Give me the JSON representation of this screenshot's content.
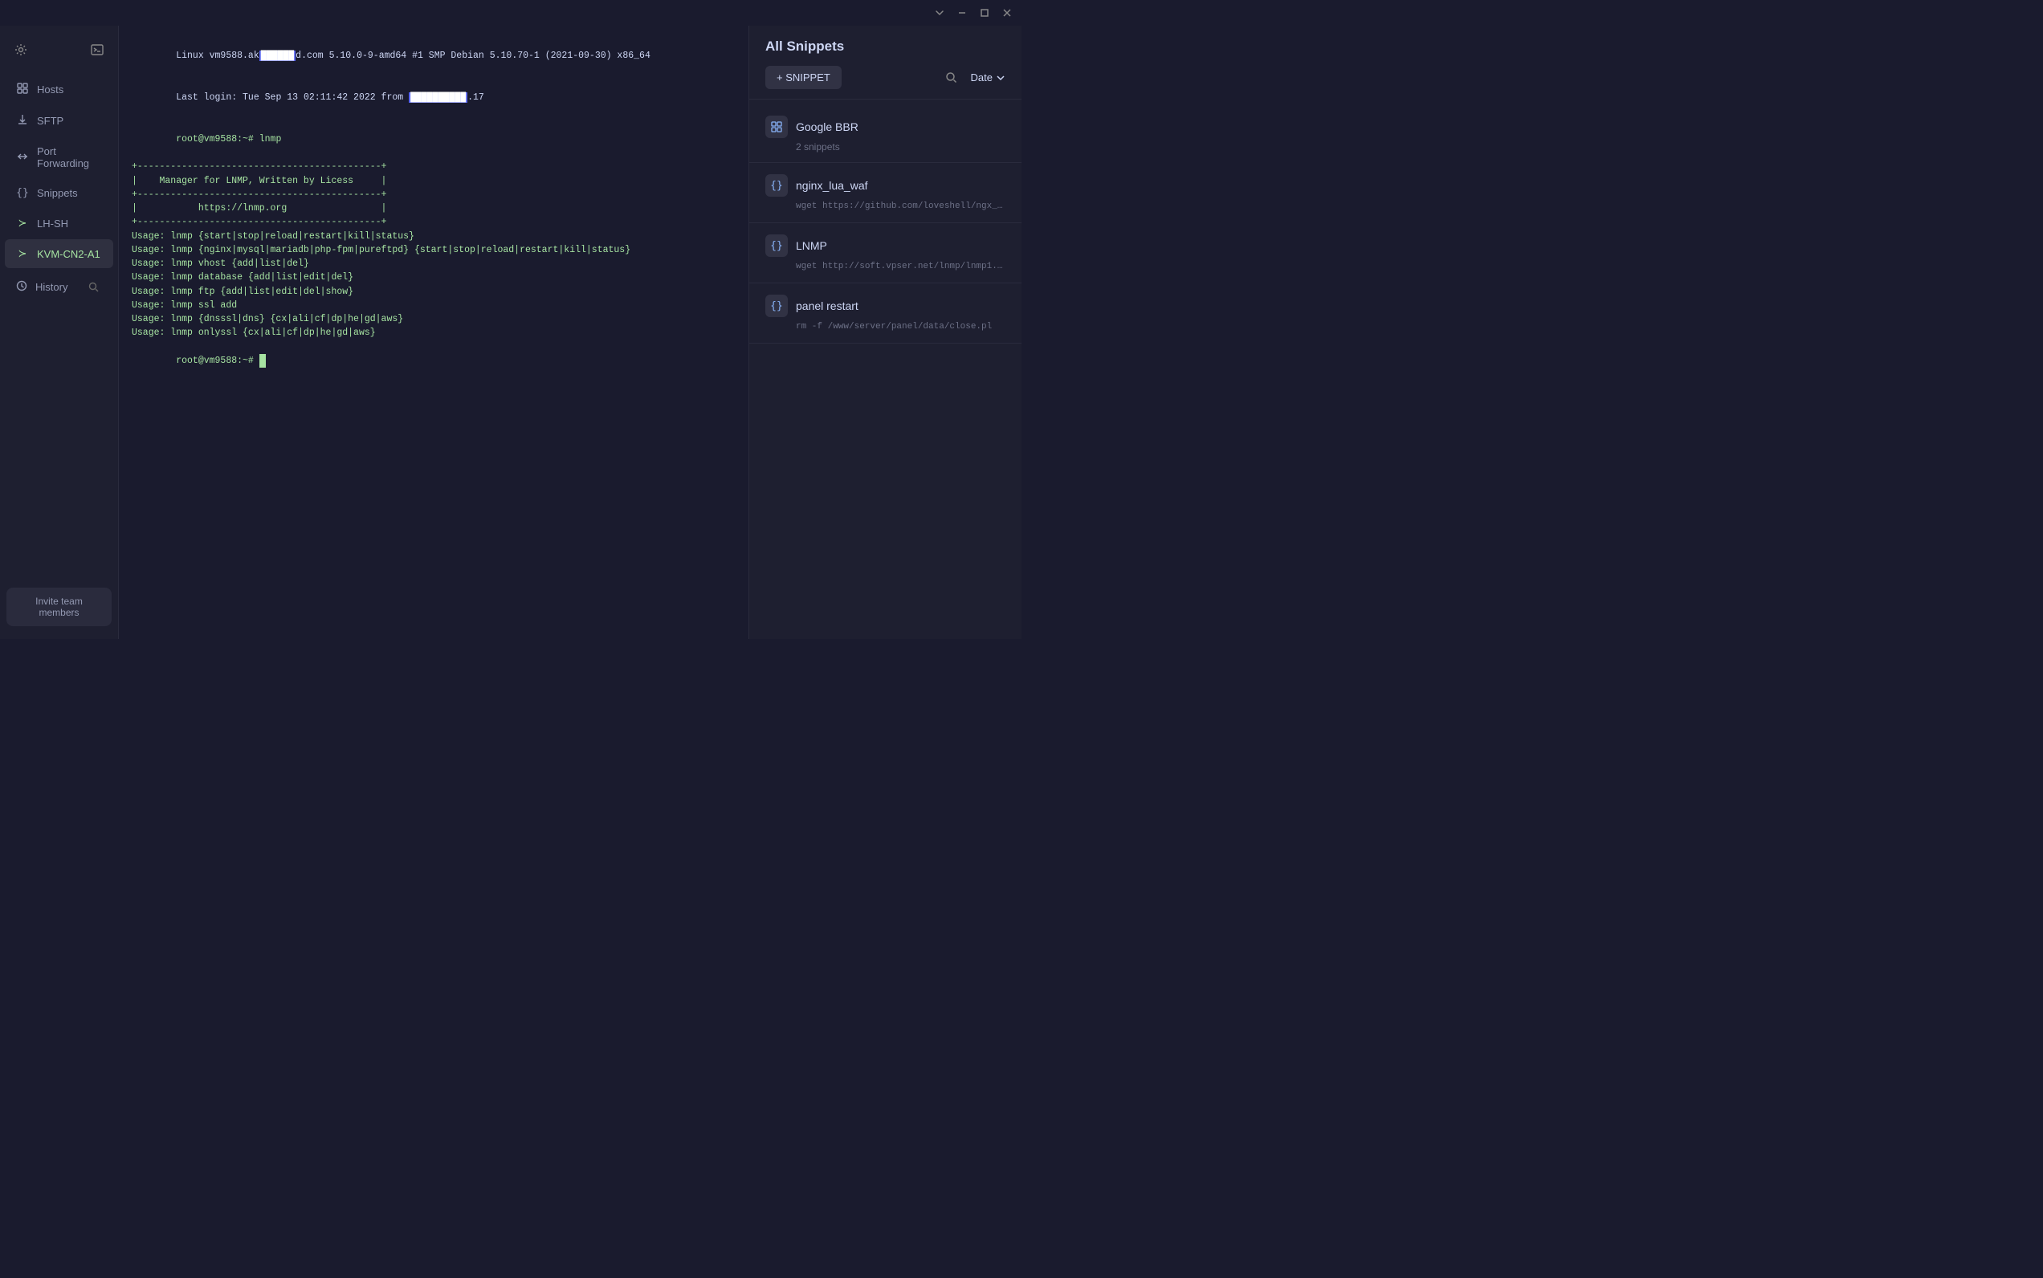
{
  "titlebar": {
    "chevron_down": "⌄",
    "minimize": "—",
    "maximize": "□",
    "close": "✕"
  },
  "sidebar": {
    "settings_icon": "⚙",
    "terminal_icon": "⬚",
    "items": [
      {
        "id": "hosts",
        "label": "Hosts",
        "icon": "⊞",
        "active": false
      },
      {
        "id": "sftp",
        "label": "SFTP",
        "icon": "⤒",
        "active": false
      },
      {
        "id": "port-forwarding",
        "label": "Port Forwarding",
        "icon": "↔",
        "active": false
      },
      {
        "id": "snippets",
        "label": "Snippets",
        "icon": "{}",
        "active": false
      },
      {
        "id": "lh-sh",
        "label": "LH-SH",
        "icon": "≻",
        "active": false
      },
      {
        "id": "kvm-cn2-a1",
        "label": "KVM-CN2-A1",
        "icon": "≻",
        "active": true
      }
    ],
    "history": {
      "label": "History",
      "icon": "○"
    },
    "invite_label": "Invite team members"
  },
  "terminal": {
    "lines": [
      {
        "type": "system",
        "content": "Linux vm9588.ak██████d.com 5.10.0-9-amd64 #1 SMP Debian 5.10.70-1 (2021-09-30) x86_64"
      },
      {
        "type": "system",
        "content": "Last login: Tue Sep 13 02:11:42 2022 from ██████████.17"
      },
      {
        "type": "prompt",
        "content": "root@vm9588:~# lnmp"
      },
      {
        "type": "output",
        "content": "+--------------------------------------------+"
      },
      {
        "type": "output",
        "content": "|    Manager for LNMP, Written by Licess     |"
      },
      {
        "type": "output",
        "content": "+--------------------------------------------+"
      },
      {
        "type": "output",
        "content": "|           https://lnmp.org                 |"
      },
      {
        "type": "output",
        "content": "+--------------------------------------------+"
      },
      {
        "type": "output",
        "content": "Usage: lnmp {start|stop|reload|restart|kill|status}"
      },
      {
        "type": "output",
        "content": "Usage: lnmp {nginx|mysql|mariadb|php-fpm|pureftpd} {start|stop|reload|restart|kill|status}"
      },
      {
        "type": "output",
        "content": "Usage: lnmp vhost {add|list|del}"
      },
      {
        "type": "output",
        "content": "Usage: lnmp database {add|list|edit|del}"
      },
      {
        "type": "output",
        "content": "Usage: lnmp ftp {add|list|edit|del|show}"
      },
      {
        "type": "output",
        "content": "Usage: lnmp ssl add"
      },
      {
        "type": "output",
        "content": "Usage: lnmp {dnsssl|dns} {cx|ali|cf|dp|he|gd|aws}"
      },
      {
        "type": "output",
        "content": "Usage: lnmp onlyssl {cx|ali|cf|dp|he|gd|aws}"
      },
      {
        "type": "prompt_cursor",
        "content": "root@vm9588:~# "
      }
    ]
  },
  "snippets_panel": {
    "title": "All Snippets",
    "add_label": "+ SNIPPET",
    "date_label": "Date",
    "groups": [
      {
        "id": "google-bbr",
        "name": "Google BBR",
        "count": "2 snippets",
        "icon": "⊞"
      }
    ],
    "items": [
      {
        "id": "nginx-lua-waf",
        "name": "nginx_lua_waf",
        "preview": "wget https://github.com/loveshell/ngx_l···",
        "icon": "{}"
      },
      {
        "id": "lnmp",
        "name": "LNMP",
        "preview": "wget http://soft.vpser.net/lnmp/lnmp1.9···",
        "icon": "{}"
      },
      {
        "id": "panel-restart",
        "name": "panel restart",
        "preview": "rm -f /www/server/panel/data/close.pl",
        "icon": "{}"
      }
    ]
  }
}
